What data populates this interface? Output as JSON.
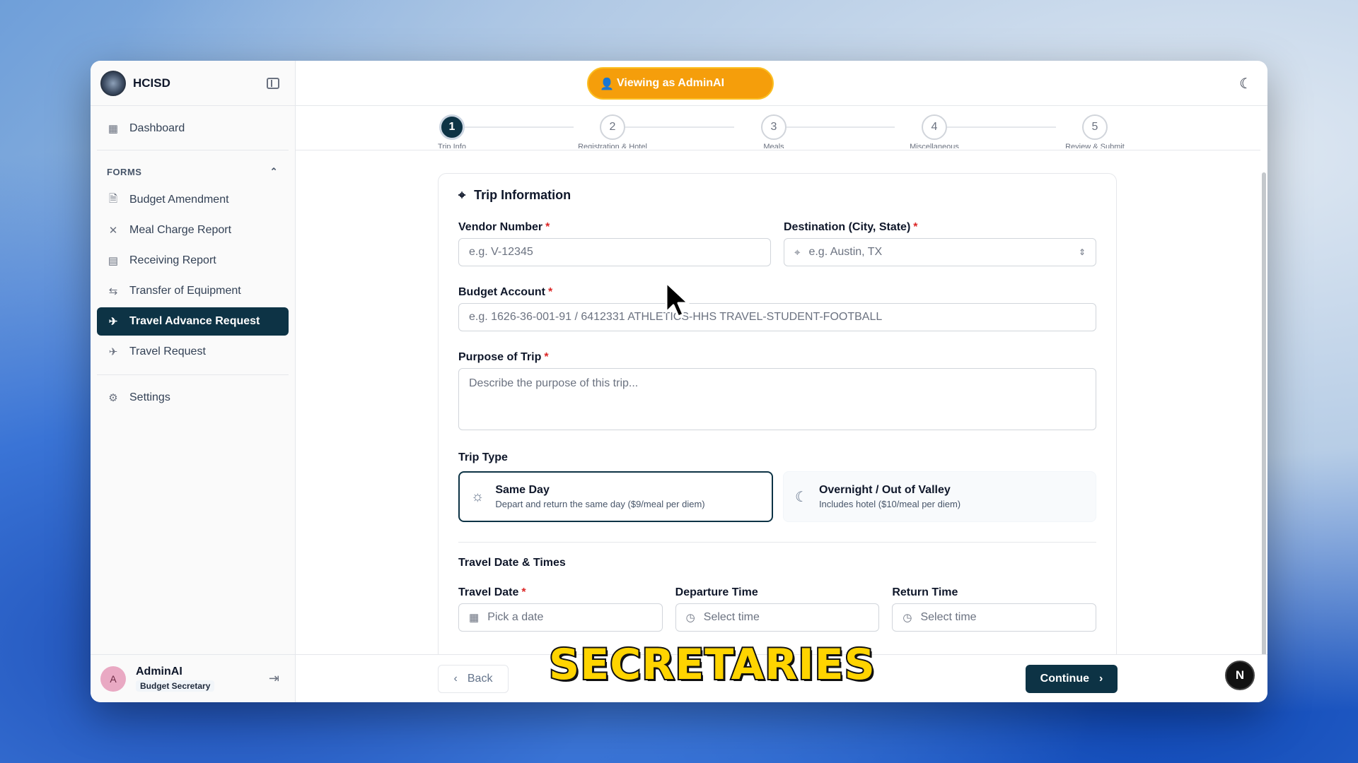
{
  "sidebar": {
    "brand": "HCISD",
    "dashboard": "Dashboard",
    "forms_label": "FORMS",
    "items": [
      {
        "label": "Budget Amendment",
        "icon": "document-icon"
      },
      {
        "label": "Meal Charge Report",
        "icon": "utensils-icon"
      },
      {
        "label": "Receiving Report",
        "icon": "clipboard-icon"
      },
      {
        "label": "Transfer of Equipment",
        "icon": "arrows-swap-icon"
      },
      {
        "label": "Travel Advance Request",
        "icon": "plane-icon",
        "active": true
      },
      {
        "label": "Travel Request",
        "icon": "plane-icon"
      }
    ],
    "settings": "Settings",
    "user": {
      "initial": "A",
      "name": "AdminAI",
      "role": "Budget Secretary"
    }
  },
  "topbar": {
    "viewing_as": "Viewing as AdminAI"
  },
  "stepper": {
    "steps": [
      {
        "number": "1",
        "label": "Trip Info",
        "active": true
      },
      {
        "number": "2",
        "label": "Registration & Hotel"
      },
      {
        "number": "3",
        "label": "Meals"
      },
      {
        "number": "4",
        "label": "Miscellaneous"
      },
      {
        "number": "5",
        "label": "Review & Submit"
      }
    ]
  },
  "form": {
    "title": "Trip Information",
    "vendor_label": "Vendor Number",
    "vendor_placeholder": "e.g. V-12345",
    "destination_label": "Destination (City, State)",
    "destination_placeholder": "e.g. Austin, TX",
    "budget_label": "Budget Account",
    "budget_placeholder": "e.g. 1626-36-001-91 / 6412331 ATHLETICS-HHS TRAVEL-STUDENT-FOOTBALL",
    "purpose_label": "Purpose of Trip",
    "purpose_placeholder": "Describe the purpose of this trip...",
    "trip_type_label": "Trip Type",
    "trip_types": [
      {
        "title": "Same Day",
        "desc": "Depart and return the same day ($9/meal per diem)",
        "selected": true
      },
      {
        "title": "Overnight / Out of Valley",
        "desc": "Includes hotel ($10/meal per diem)",
        "selected": false
      }
    ],
    "dates_heading": "Travel Date & Times",
    "travel_date_label": "Travel Date",
    "travel_date_placeholder": "Pick a date",
    "departure_label": "Departure Time",
    "departure_placeholder": "Select time",
    "return_label": "Return Time",
    "return_placeholder": "Select time"
  },
  "footer": {
    "back": "Back",
    "continue": "Continue",
    "badge": "N"
  },
  "overlay_caption": "SECRETARIES",
  "colors": {
    "primary": "#0d3345",
    "accent": "#f59e0b",
    "required": "#dc2626"
  }
}
